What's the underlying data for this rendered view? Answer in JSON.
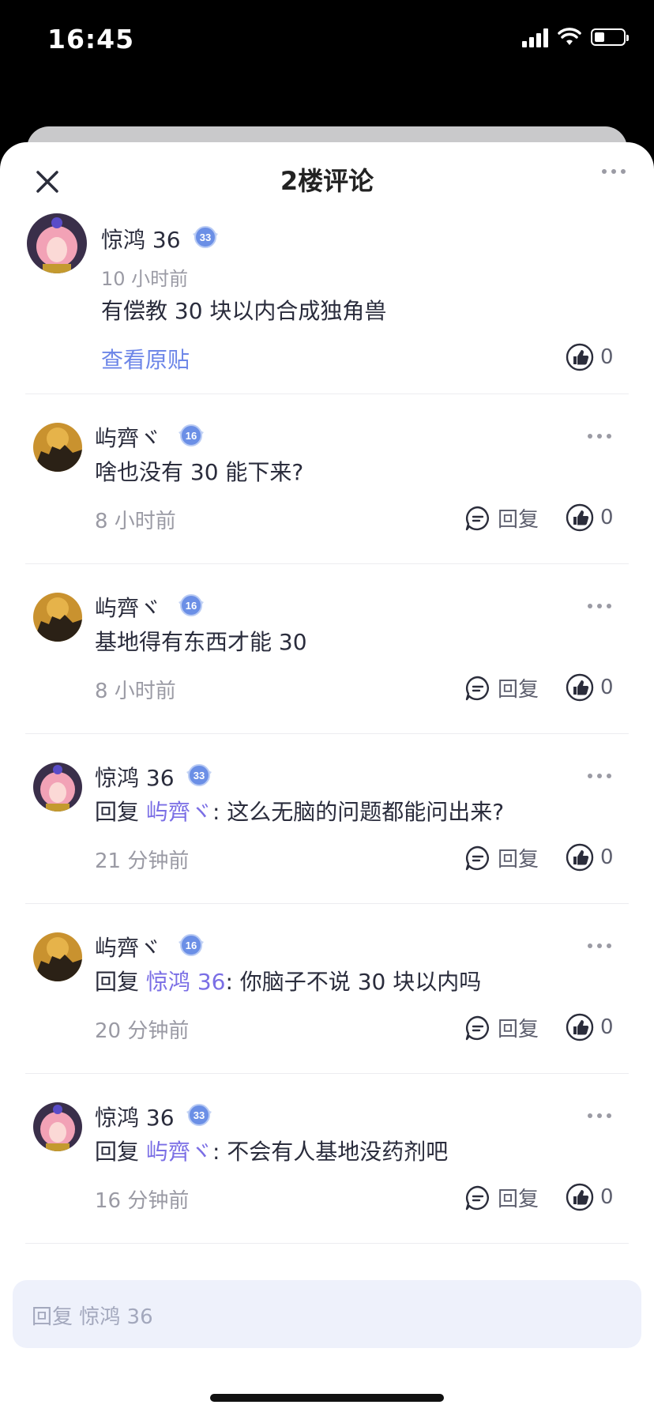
{
  "status": {
    "time": "16:45",
    "battery_level": 0.35
  },
  "header": {
    "title": "2楼评论"
  },
  "main_post": {
    "user": "惊鸿 36",
    "level": "33",
    "time": "10 小时前",
    "text": "有偿教 30 块以内合成独角兽",
    "view_original": "查看原贴",
    "likes": "0"
  },
  "comments": [
    {
      "user": "屿齊ヾ",
      "level": "16",
      "text": "啥也没有 30 能下来?",
      "reply_prefix": "",
      "reply_to": "",
      "reply_sep": "",
      "time": "8 小时前",
      "reply_label": "回复",
      "likes": "0"
    },
    {
      "user": "屿齊ヾ",
      "level": "16",
      "text": "基地得有东西才能 30",
      "reply_prefix": "",
      "reply_to": "",
      "reply_sep": "",
      "time": "8 小时前",
      "reply_label": "回复",
      "likes": "0"
    },
    {
      "user": "惊鸿 36",
      "level": "33",
      "reply_prefix": "回复",
      "reply_to": "屿齊ヾ",
      "reply_sep": ":",
      "text": "这么无脑的问题都能问出来?",
      "time": "21 分钟前",
      "reply_label": "回复",
      "likes": "0"
    },
    {
      "user": "屿齊ヾ",
      "level": "16",
      "reply_prefix": "回复",
      "reply_to": "惊鸿 36",
      "reply_sep": ":",
      "text": "你脑子不说 30 块以内吗",
      "time": "20 分钟前",
      "reply_label": "回复",
      "likes": "0"
    },
    {
      "user": "惊鸿 36",
      "level": "33",
      "reply_prefix": "回复",
      "reply_to": "屿齊ヾ",
      "reply_sep": ":",
      "text": "不会有人基地没药剂吧",
      "time": "16 分钟前",
      "reply_label": "回复",
      "likes": "0"
    }
  ],
  "input": {
    "placeholder": "回复 惊鸿 36"
  },
  "colors": {
    "accent": "#6d86e8",
    "reply_name": "#7a6ee5",
    "input_bg": "#eef1fb"
  }
}
